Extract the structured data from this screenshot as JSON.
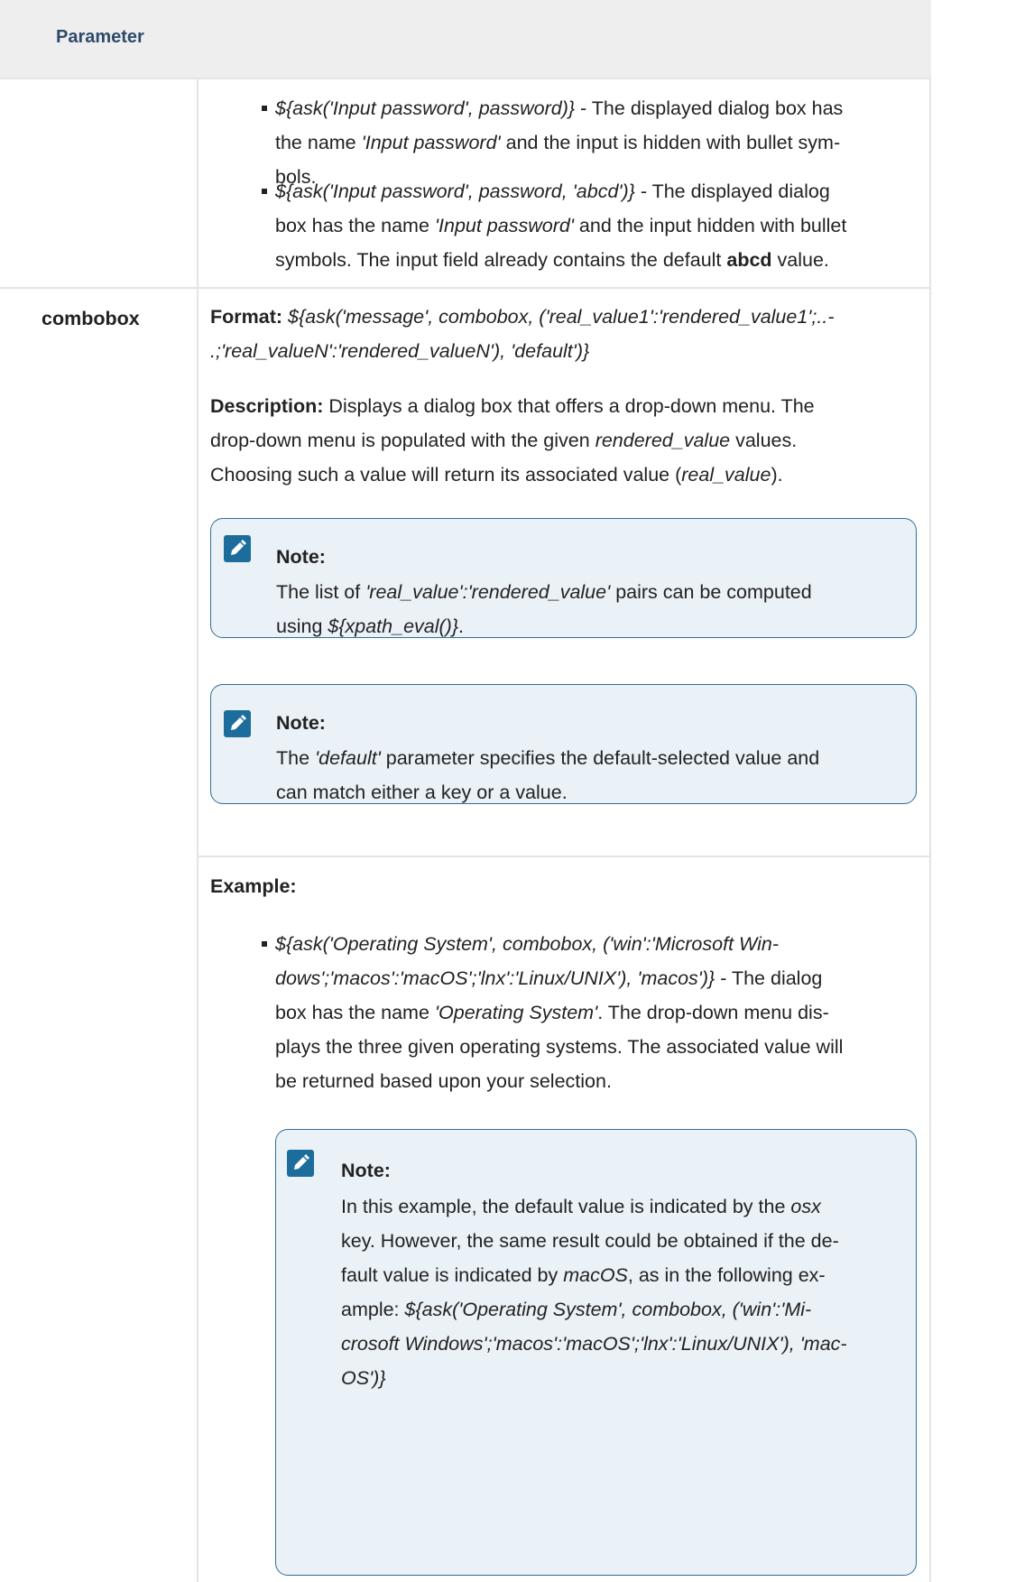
{
  "table": {
    "header": {
      "parameter_label": "Parameter"
    }
  },
  "password_examples": [
    {
      "code": "${ask('Input password', password)}",
      "dash": " - ",
      "line1_rest": "The displayed dialog box has",
      "line2_a": "the name ",
      "line2_it": "'Input password'",
      "line2_b": " and the input is hidden with bullet sym-",
      "line3": "bols."
    },
    {
      "code": "${ask('Input password', password, 'abcd')}",
      "dash": " - ",
      "line1_rest": "The displayed dialog",
      "line2_a": "box has the name ",
      "line2_it": "'Input password'",
      "line2_b": " and the input hidden with bullet",
      "line3_a": "symbols. The input field already contains the default ",
      "line3_bold": "abcd",
      "line3_b": " value."
    }
  ],
  "combobox": {
    "name": "combobox",
    "format_label": "Format:",
    "format_line1": "${ask('message', combobox, ('real_value1':'rendered_value1';..-",
    "format_line2": ".;'real_valueN':'rendered_valueN'), 'default')}",
    "description_label": "Description:",
    "desc_line1": "Displays a dialog box that offers a drop-down menu. The",
    "desc_line2_a": "drop-down menu is populated with the given ",
    "desc_line2_it": "rendered_value",
    "desc_line2_b": " values.",
    "desc_line3_a": "Choosing such a value will return its associated value (",
    "desc_line3_it": "real_value",
    "desc_line3_b": ").",
    "note1": {
      "title": "Note:",
      "line1_a": "The list of ",
      "line1_it": "'real_value':'rendered_value'",
      "line1_b": " pairs can be computed",
      "line2_a": "using ",
      "line2_it": "${xpath_eval()}",
      "line2_b": "."
    },
    "note2": {
      "title": "Note:",
      "line1_a": "The ",
      "line1_it": "'default'",
      "line1_b": " parameter specifies the default-selected value and",
      "line2": "can match either a key or a value."
    },
    "example_label": "Example:",
    "example": {
      "line1": "${ask('Operating System', combobox, ('win':'Microsoft Win-",
      "line2_it": "dows';'macos':'macOS';'lnx':'Linux/UNIX'), 'macos')}",
      "line2_b": " - The dialog",
      "line3_a": "box has the name ",
      "line3_it": "'Operating System'",
      "line3_b": ". The drop-down menu dis-",
      "line4": "plays the three given operating systems. The associated value will",
      "line5": "be returned based upon your selection."
    },
    "note3": {
      "title": "Note:",
      "line1_a": "In this example, the default value is indicated by the ",
      "line1_it": "osx",
      "line2": "key. However, the same result could be obtained if the de-",
      "line3_a": "fault value is indicated by ",
      "line3_it": "macOS",
      "line3_b": ", as in the following ex-",
      "line4_a": "ample: ",
      "line4_it": "${ask('Operating System', combobox, ('win':'Mi-",
      "line5_it": "crosoft Windows';'macos':'macOS';'lnx':'Linux/UNIX'), 'mac-",
      "line6_it": "OS')}"
    }
  },
  "icons": {
    "note": "pencil-icon"
  },
  "colors": {
    "note_bg": "#eaf1f7",
    "note_border": "#2f6f9a",
    "icon_bg": "#1d6d9c",
    "header_text": "#2e4a6b"
  }
}
